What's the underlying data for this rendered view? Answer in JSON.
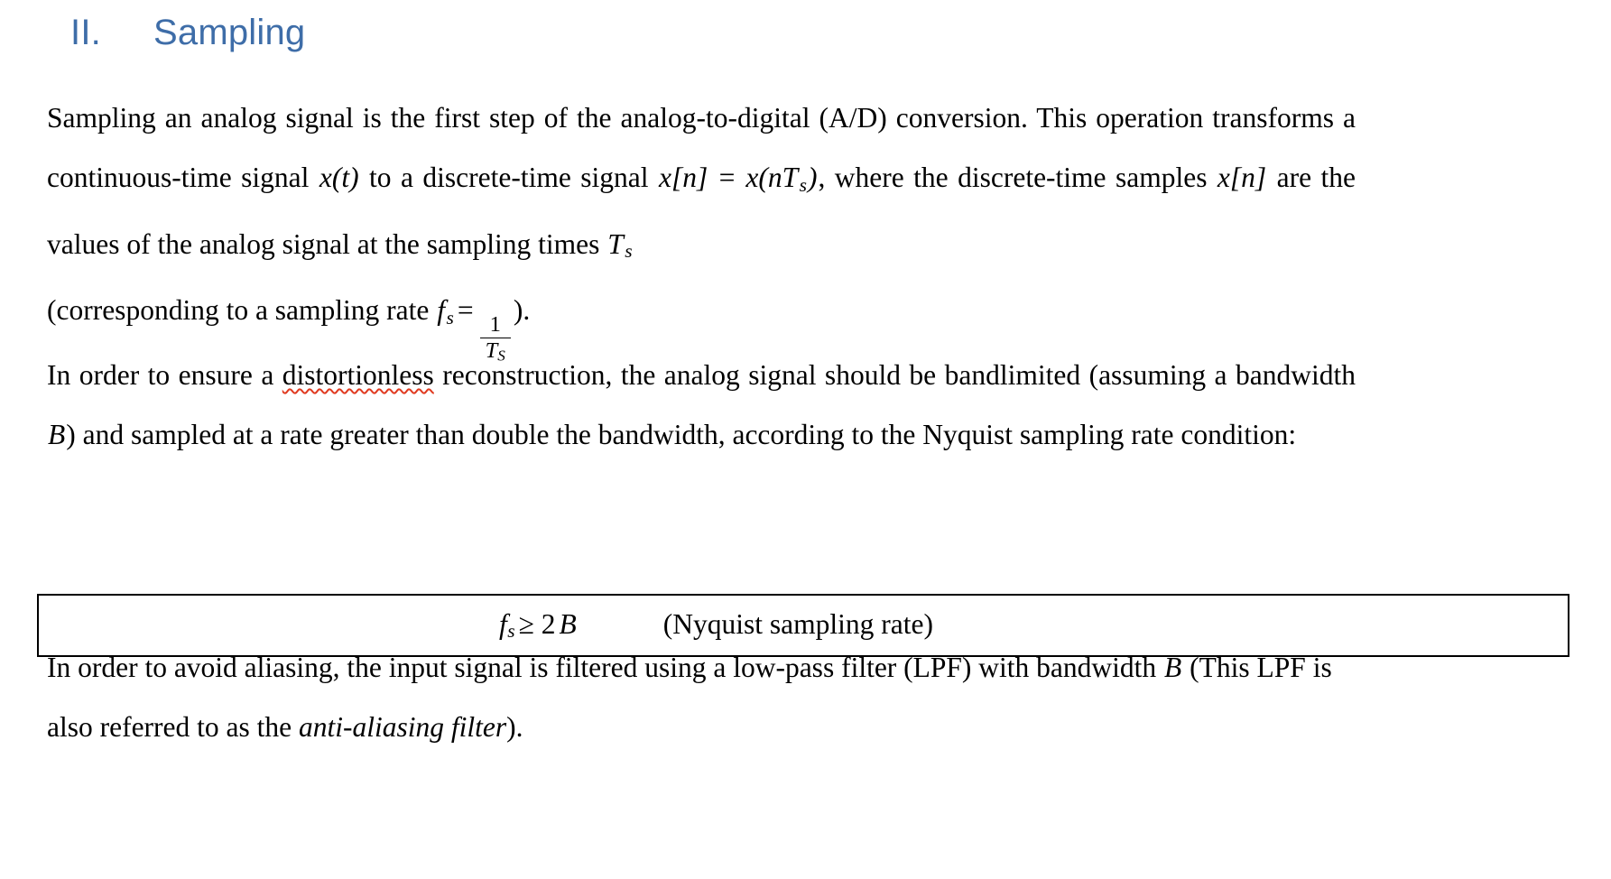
{
  "document": {
    "heading": {
      "number": "II.",
      "title": "Sampling",
      "color": "#3E6DA8"
    },
    "paragraph1": {
      "segment_a": "Sampling an analog signal is the first step of the analog-to-digital (A/D) conversion. This operation transforms a continuous-time signal ",
      "math_xt": "x(t)",
      "segment_b": " to a discrete-time signal ",
      "math_xn_eq": "x[n] = x(nT",
      "math_xn_sub": "s",
      "math_xn_close": ")",
      "segment_c": ", where the discrete-time samples ",
      "math_xn2": "x[n]",
      "segment_d": " are the values of the analog signal at the sampling times ",
      "math_Ts_var": "T",
      "math_Ts_sub": "s",
      "segment_e": "(corresponding to a sampling rate ",
      "math_fs_var": "f",
      "math_fs_sub": "s",
      "math_equals": "=",
      "frac_numerator": "1",
      "frac_denominator": "T",
      "frac_denominator_sub": "S",
      "segment_f": ")."
    },
    "paragraph2": {
      "segment_a": "In order to ensure a ",
      "misspelled_word": "distortionless",
      "segment_b": " reconstruction, the analog signal should be bandlimited (assuming a bandwidth ",
      "math_B": "B",
      "segment_c": ") and sampled at a rate greater than double the bandwidth, according to the Nyquist sampling rate condition:",
      "spellcheck_underline_color": "#E03A20"
    },
    "equation_box": {
      "math_fs": "f",
      "math_fs_sub": "s",
      "math_rel": "≥ 2",
      "math_B": "B",
      "note": "(Nyquist sampling rate)"
    },
    "paragraph3": {
      "segment_a": "In order to avoid aliasing, the input signal is filtered using a low-pass filter (LPF) with bandwidth ",
      "math_B": "B",
      "segment_b": " (This LPF is also referred to as the ",
      "italic_term": "anti-aliasing filter",
      "segment_c": ")."
    }
  }
}
